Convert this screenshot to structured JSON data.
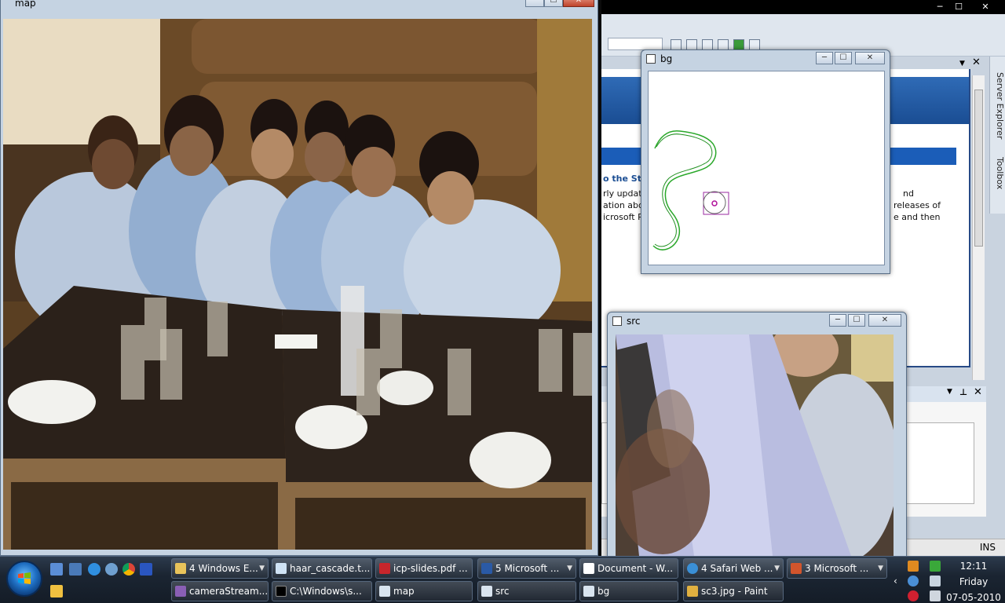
{
  "ide": {
    "doc_heading": "o the Sta",
    "doc_lines": [
      "rly updat",
      "ation abo",
      "icrosoft P"
    ],
    "doc_lines_right": [
      "nd",
      "releases of",
      "e and then"
    ],
    "side_tabs": [
      "Server Explorer",
      "Toolbox"
    ],
    "status_ins": "INS"
  },
  "windows": {
    "map": {
      "title": "map"
    },
    "bg": {
      "title": "bg"
    },
    "src": {
      "title": "src"
    }
  },
  "caption_buttons": {
    "minimize": "─",
    "maximize": "☐",
    "close": "✕"
  },
  "taskbar": {
    "row1": [
      {
        "label": "4 Windows E...",
        "icon": "folder-icon",
        "color": "#e8c35a",
        "dropdown": true
      },
      {
        "label": "haar_cascade.t...",
        "icon": "notepad-icon",
        "color": "#cfe3f5",
        "dropdown": false
      },
      {
        "label": "icp-slides.pdf ...",
        "icon": "pdf-icon",
        "color": "#c8262c",
        "dropdown": false
      },
      {
        "label": "5 Microsoft ...",
        "icon": "word-icon",
        "color": "#2a5aa6",
        "dropdown": true
      },
      {
        "label": "Document - W...",
        "icon": "wordpad-icon",
        "color": "#ffffff",
        "dropdown": false
      },
      {
        "label": "4 Safari Web ...",
        "icon": "safari-icon",
        "color": "#3a8fd6",
        "dropdown": true
      },
      {
        "label": "3 Microsoft ...",
        "icon": "powerpoint-icon",
        "color": "#d2552c",
        "dropdown": true
      }
    ],
    "row2": [
      {
        "label": "cameraStream...",
        "icon": "vs-icon",
        "color": "#8a5fb5"
      },
      {
        "label": "C:\\Windows\\s...",
        "icon": "cmd-icon",
        "color": "#000000"
      },
      {
        "label": "map",
        "icon": "window-icon",
        "color": "#d9e4ef"
      },
      {
        "label": "src",
        "icon": "window-icon",
        "color": "#d9e4ef"
      },
      {
        "label": "bg",
        "icon": "window-icon",
        "color": "#d9e4ef"
      },
      {
        "label": "sc3.jpg - Paint",
        "icon": "paint-icon",
        "color": "#e0b040"
      }
    ]
  },
  "clock": {
    "time": "12:11",
    "day": "Friday",
    "date": "07-05-2010"
  }
}
